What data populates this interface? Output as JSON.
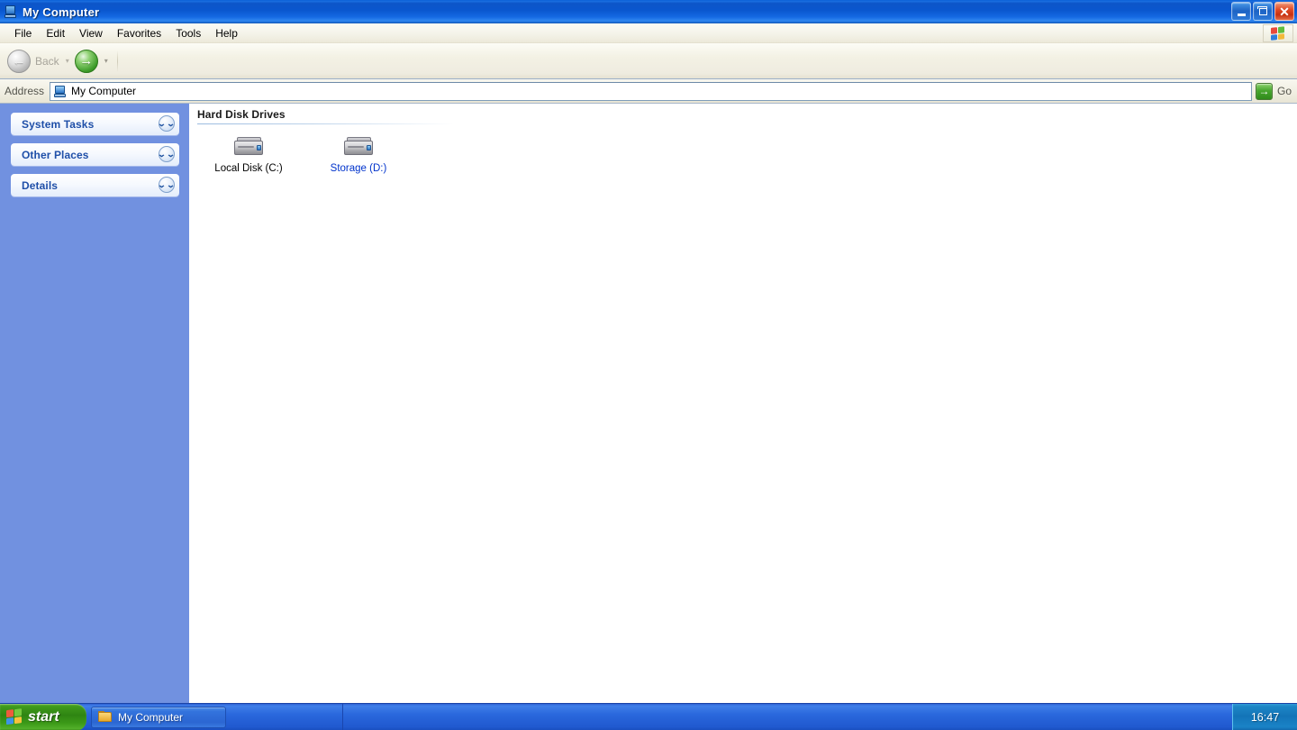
{
  "window": {
    "title": "My Computer",
    "icon": "my-computer-icon",
    "controls": {
      "minimize": "_",
      "maximize": "□",
      "close": "✕"
    }
  },
  "menubar": {
    "items": [
      {
        "label": "File"
      },
      {
        "label": "Edit"
      },
      {
        "label": "View"
      },
      {
        "label": "Favorites"
      },
      {
        "label": "Tools"
      },
      {
        "label": "Help"
      }
    ],
    "brand_icon": "windows-flag-icon"
  },
  "toolbar": {
    "back_label": "Back",
    "back_enabled": false,
    "forward_label": "",
    "forward_enabled": true,
    "dropdown_caret": "▾"
  },
  "address": {
    "label": "Address",
    "value": "My Computer",
    "icon": "my-computer-icon",
    "go_label": "Go",
    "go_icon": "green-arrow-icon"
  },
  "sidebar": {
    "panels": [
      {
        "title": "System Tasks",
        "expander": "chevron-double-down-icon",
        "glyph": "»"
      },
      {
        "title": "Other Places",
        "expander": "chevron-double-down-icon",
        "glyph": "»"
      },
      {
        "title": "Details",
        "expander": "chevron-double-down-icon",
        "glyph": "»"
      }
    ]
  },
  "content": {
    "group_header": "Hard Disk Drives",
    "drives": [
      {
        "label": "Local Disk (C:)",
        "icon": "hard-drive-icon",
        "state": "normal"
      },
      {
        "label": "Storage (D:)",
        "icon": "hard-drive-icon",
        "state": "hover"
      }
    ]
  },
  "taskbar": {
    "start_label": "start",
    "start_icon": "windows-flag-icon",
    "items": [
      {
        "label": "My Computer",
        "icon": "folder-icon"
      }
    ],
    "clock": "16:47"
  },
  "colors": {
    "titlebar_blue": "#0a57cf",
    "sidebar_blue": "#7191e0",
    "taskbar_blue": "#2a68dd",
    "start_green": "#3f9a1c",
    "link_blue": "#0033cc",
    "panel_title_blue": "#1f4fa8"
  }
}
